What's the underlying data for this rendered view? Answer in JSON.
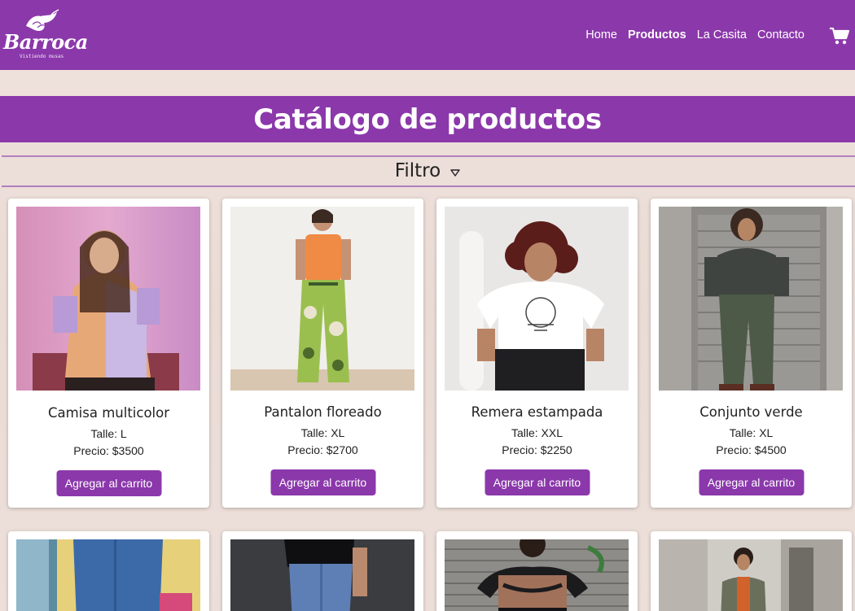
{
  "brand": {
    "name": "Barroca",
    "tagline": "Vistiendo musas"
  },
  "nav": {
    "links": [
      {
        "label": "Home",
        "active": false
      },
      {
        "label": "Productos",
        "active": true
      },
      {
        "label": "La Casita",
        "active": false
      },
      {
        "label": "Contacto",
        "active": false
      }
    ],
    "cart_icon": "shopping-cart-icon"
  },
  "page": {
    "title": "Catálogo de productos"
  },
  "filter": {
    "label": "Filtro",
    "icon": "caret-down-icon"
  },
  "products": [
    {
      "name": "Camisa multicolor",
      "size": "Talle: L",
      "price": "Precio: $3500",
      "button": "Agregar al carrito"
    },
    {
      "name": "Pantalon floreado",
      "size": "Talle: XL",
      "price": "Precio: $2700",
      "button": "Agregar al carrito"
    },
    {
      "name": "Remera estampada",
      "size": "Talle: XXL",
      "price": "Precio: $2250",
      "button": "Agregar al carrito"
    },
    {
      "name": "Conjunto verde",
      "size": "Talle: XL",
      "price": "Precio: $4500",
      "button": "Agregar al carrito"
    }
  ],
  "colors": {
    "accent": "#8b38ab",
    "background": "#eddfd9",
    "card": "#ffffff"
  }
}
